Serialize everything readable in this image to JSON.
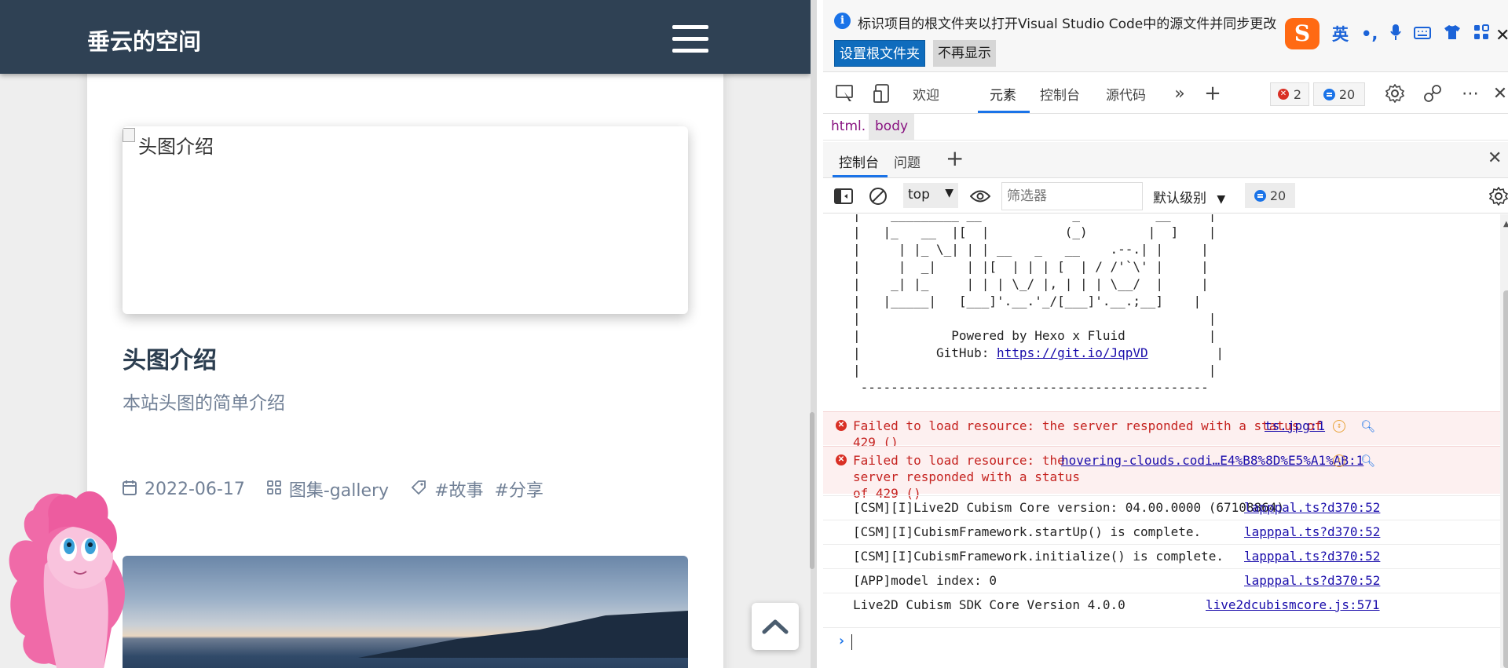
{
  "blog": {
    "brand": "垂云的空间",
    "post1": {
      "image_alt": "头图介绍",
      "title": "头图介绍",
      "excerpt": "本站头图的简单介绍",
      "date": "2022-06-17",
      "category": "图集-gallery",
      "tags": "#故事  #分享"
    }
  },
  "devtools": {
    "infobar": {
      "text": "标识项目的根文件夹以打开Visual Studio Code中的源文件并同步更改",
      "set_root_label": "设置根文件夹",
      "dont_show_label": "不再显示"
    },
    "ime": {
      "logo": "S",
      "lang": "英"
    },
    "main_tabs": {
      "welcome": "欢迎",
      "elements": "元素",
      "console": "控制台",
      "sources": "源代码"
    },
    "error_count": "2",
    "message_count": "20",
    "breadcrumb": {
      "html": "html.",
      "body": "body"
    },
    "drawer_tabs": {
      "console": "控制台",
      "issues": "问题"
    },
    "console_toolbar": {
      "context": "top",
      "filter_placeholder": "筛选器",
      "level": "默认级别",
      "message_count": "20"
    },
    "console": {
      "ascii_lines": [
        "|    _________ __            _          __     |",
        "|   |_   __  |[  |          (_)        |  ]    |",
        "|     | |_ \\_| | | __   _   __    .--.| |     |",
        "|     |  _|    | |[  | | | [  | / /'`\\' |     |",
        "|    _| |_     | | | \\_/ |, | | | \\__/  |     |",
        "|   |_____|   [___]'.__.'_/[___]'.__.;__]    |",
        "|                                              |",
        "|            Powered by Hexo x Fluid           |",
        "|          GitHub: ",
        "|                                              |",
        " ----------------------------------------------"
      ],
      "github_link": "https://git.io/JqpVD",
      "errors": [
        {
          "text": "Failed to load resource: the server responded with a status of\n429 ()",
          "source": "ts.jpg:1"
        },
        {
          "text": "Failed to load resource: the\nserver responded with a status\nof 429 ()",
          "source": "hovering-clouds.codi…E4%B8%8D%E5%A1%AB:1"
        }
      ],
      "logs": [
        {
          "text": "[CSM][I]Live2D Cubism Core version: 04.00.0000 (67108864)",
          "source": "lapppal.ts?d370:52"
        },
        {
          "text": "[CSM][I]CubismFramework.startUp() is complete.",
          "source": "lapppal.ts?d370:52"
        },
        {
          "text": "[CSM][I]CubismFramework.initialize() is complete.",
          "source": "lapppal.ts?d370:52"
        },
        {
          "text": "[APP]model index: 0",
          "source": "lapppal.ts?d370:52"
        },
        {
          "text": "Live2D Cubism SDK Core Version 4.0.0",
          "source": "live2dcubismcore.js:571"
        }
      ]
    }
  },
  "colors": {
    "navbar": "#2f4154",
    "accent": "#1a73e8",
    "error": "#d93025"
  }
}
